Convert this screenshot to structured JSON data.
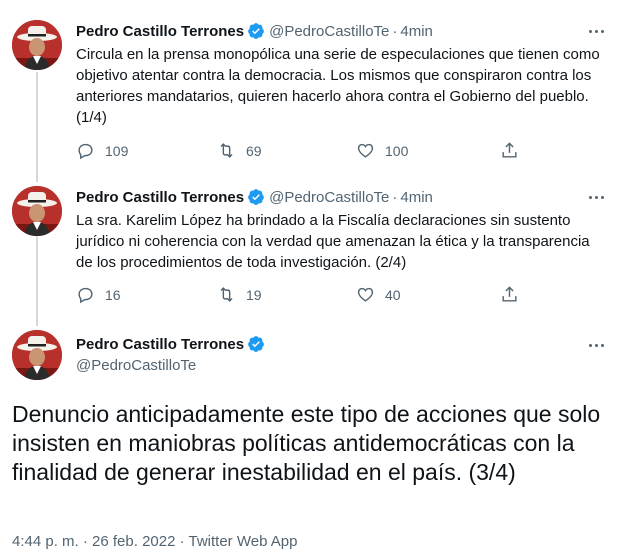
{
  "tweets": [
    {
      "name": "Pedro Castillo Terrones",
      "handle": "@PedroCastilloTe",
      "separator": "·",
      "time": "4min",
      "text": "Circula en la prensa monopólica una serie de especulaciones que tienen como objetivo atentar contra la democracia. Los mismos que conspiraron contra los anteriores mandatarios, quieren hacerlo ahora contra el Gobierno del pueblo. (1/4)",
      "replies": "109",
      "retweets": "69",
      "likes": "100"
    },
    {
      "name": "Pedro Castillo Terrones",
      "handle": "@PedroCastilloTe",
      "separator": "·",
      "time": "4min",
      "text": "La sra. Karelim López ha brindado a la Fiscalía declaraciones sin sustento jurídico ni coherencia con la verdad que amenazan la ética y la transparencia de los procedimientos de toda investigación. (2/4)",
      "replies": "16",
      "retweets": "19",
      "likes": "40"
    }
  ],
  "main_tweet": {
    "name": "Pedro Castillo Terrones",
    "handle": "@PedroCastilloTe",
    "text": "Denuncio anticipadamente este tipo de acciones que solo insisten en maniobras políticas antidemocráticas con la finalidad de generar inestabilidad en el país. (3/4)",
    "meta": "4:44 p. m. · 26 feb. 2022 · Twitter Web App"
  },
  "colors": {
    "verified": "#1d9bf0",
    "secondary_text": "#536471",
    "thread_line": "#cfd9de"
  },
  "icons": [
    "reply-icon",
    "retweet-icon",
    "like-icon",
    "share-icon",
    "verified-badge-icon",
    "more-icon"
  ]
}
